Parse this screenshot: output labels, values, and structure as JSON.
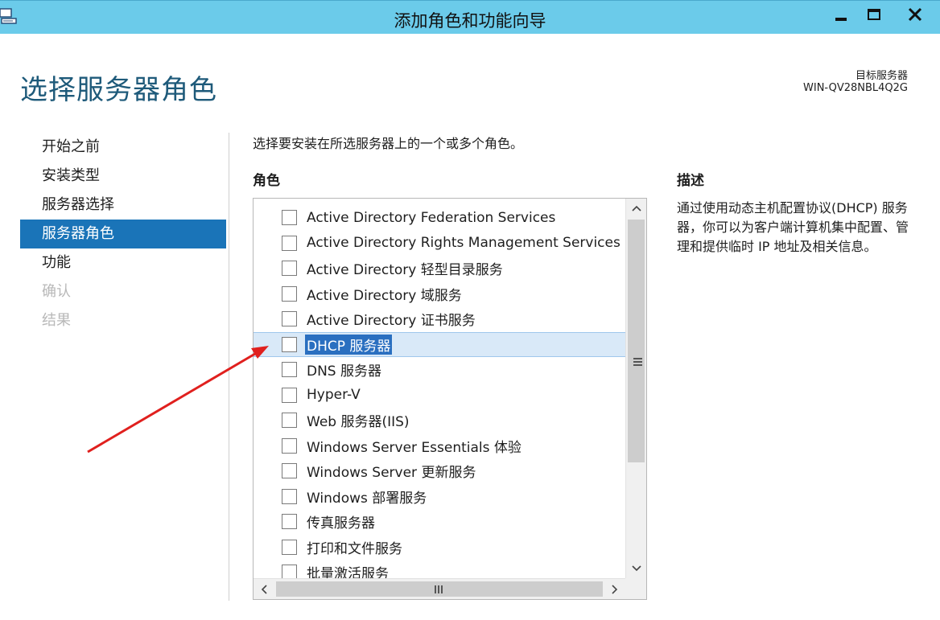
{
  "window": {
    "title": "添加角色和功能向导",
    "controls": [
      "minimize-icon",
      "maximize-icon",
      "close-icon"
    ]
  },
  "header": {
    "page_title": "选择服务器角色",
    "destination_label": "目标服务器",
    "destination_server": "WIN-QV28NBL4Q2G"
  },
  "nav": {
    "items": [
      {
        "label": "开始之前",
        "state": "normal"
      },
      {
        "label": "安装类型",
        "state": "normal"
      },
      {
        "label": "服务器选择",
        "state": "normal"
      },
      {
        "label": "服务器角色",
        "state": "active"
      },
      {
        "label": "功能",
        "state": "normal"
      },
      {
        "label": "确认",
        "state": "disabled"
      },
      {
        "label": "结果",
        "state": "disabled"
      }
    ]
  },
  "main": {
    "instruction": "选择要安装在所选服务器上的一个或多个角色。",
    "roles_heading": "角色",
    "description_heading": "描述",
    "description_text": "通过使用动态主机配置协议(DHCP) 服务器，你可以为客户端计算机集中配置、管理和提供临时 IP 地址及相关信息。",
    "roles": [
      {
        "label": "Active Directory Federation Services",
        "checked": false,
        "selected": false
      },
      {
        "label": "Active Directory Rights Management Services",
        "checked": false,
        "selected": false
      },
      {
        "label": "Active Directory 轻型目录服务",
        "checked": false,
        "selected": false
      },
      {
        "label": "Active Directory 域服务",
        "checked": false,
        "selected": false
      },
      {
        "label": "Active Directory 证书服务",
        "checked": false,
        "selected": false
      },
      {
        "label": "DHCP 服务器",
        "checked": false,
        "selected": true
      },
      {
        "label": "DNS 服务器",
        "checked": false,
        "selected": false
      },
      {
        "label": "Hyper-V",
        "checked": false,
        "selected": false
      },
      {
        "label": "Web 服务器(IIS)",
        "checked": false,
        "selected": false
      },
      {
        "label": "Windows Server Essentials 体验",
        "checked": false,
        "selected": false
      },
      {
        "label": "Windows Server 更新服务",
        "checked": false,
        "selected": false
      },
      {
        "label": "Windows 部署服务",
        "checked": false,
        "selected": false
      },
      {
        "label": "传真服务器",
        "checked": false,
        "selected": false
      },
      {
        "label": "打印和文件服务",
        "checked": false,
        "selected": false
      },
      {
        "label": "批量激活服务",
        "checked": false,
        "selected": false
      }
    ]
  },
  "annotation": {
    "color": "#e0201e"
  }
}
